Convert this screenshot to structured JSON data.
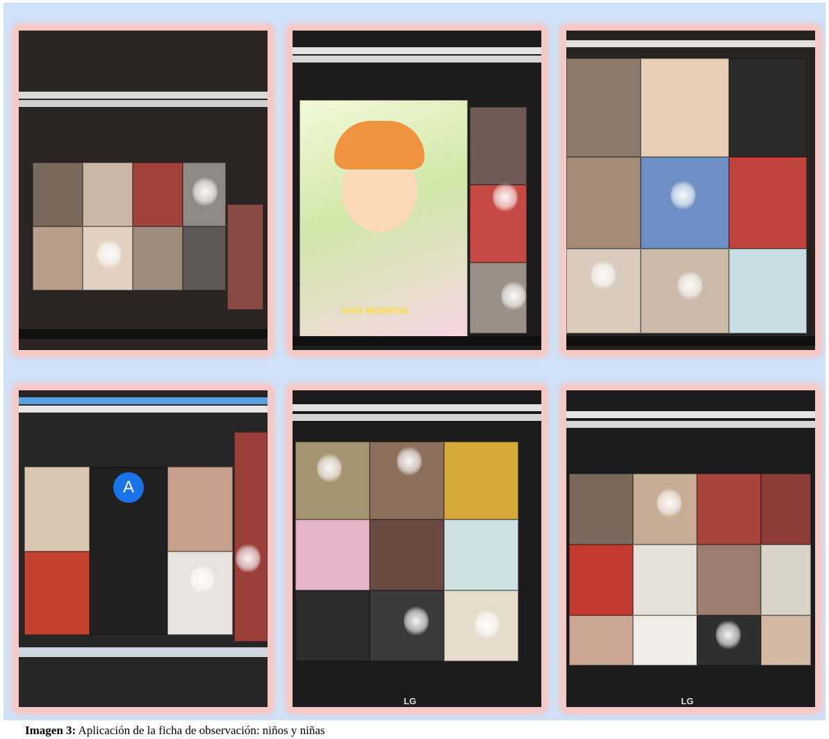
{
  "caption": {
    "label": "Imagen 3:",
    "text": " Aplicación de la ficha de observación: niños y niñas"
  },
  "photos": [
    {
      "name": "photo-meet-session-1"
    },
    {
      "name": "photo-meet-session-2",
      "overlay_text": "VIVA MORENA"
    },
    {
      "name": "photo-meet-session-3"
    },
    {
      "name": "photo-meet-session-4",
      "avatar_letter": "A"
    },
    {
      "name": "photo-meet-session-5",
      "brand": "LG"
    },
    {
      "name": "photo-meet-session-6",
      "brand": "LG"
    }
  ],
  "colors": {
    "board_background": "#cfe0f7",
    "frame_border": "#f6c9c6"
  }
}
